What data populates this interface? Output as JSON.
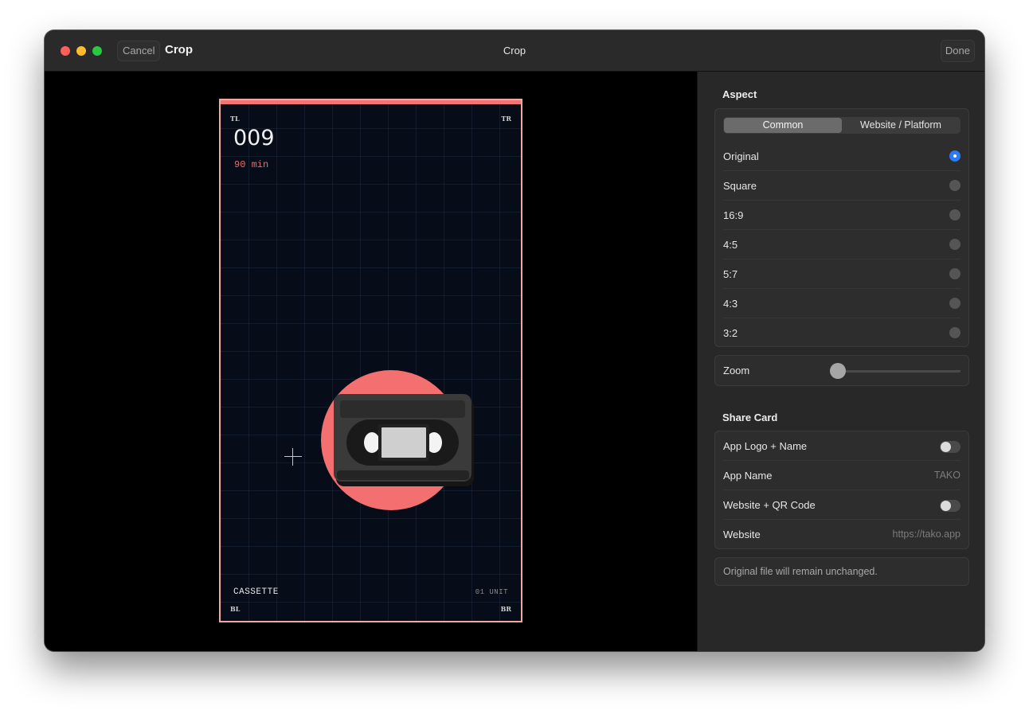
{
  "titlebar": {
    "cancel_label": "Cancel",
    "crop_label": "Crop",
    "title": "Crop",
    "done_label": "Done"
  },
  "image": {
    "corner_tl": "TL",
    "corner_tr": "TR",
    "corner_bl": "BL",
    "corner_br": "BR",
    "number": "009",
    "duration": "90 min",
    "label": "CASSETTE",
    "unit": "01 UNIT",
    "accent_color": "#f47474"
  },
  "aspect": {
    "title": "Aspect",
    "tabs": [
      "Common",
      "Website / Platform"
    ],
    "active_tab": "Common",
    "options": [
      "Original",
      "Square",
      "16:9",
      "4:5",
      "5:7",
      "4:3",
      "3:2"
    ],
    "selected": "Original",
    "accent_color": "#2d7bf0"
  },
  "zoom": {
    "label": "Zoom",
    "value": 0
  },
  "share_card": {
    "title": "Share Card",
    "app_logo_label": "App Logo + Name",
    "app_logo_enabled": false,
    "app_name_label": "App Name",
    "app_name_value": "TAKO",
    "website_qr_label": "Website + QR Code",
    "website_qr_enabled": false,
    "website_label": "Website",
    "website_value": "https://tako.app"
  },
  "note": "Original file will remain unchanged."
}
